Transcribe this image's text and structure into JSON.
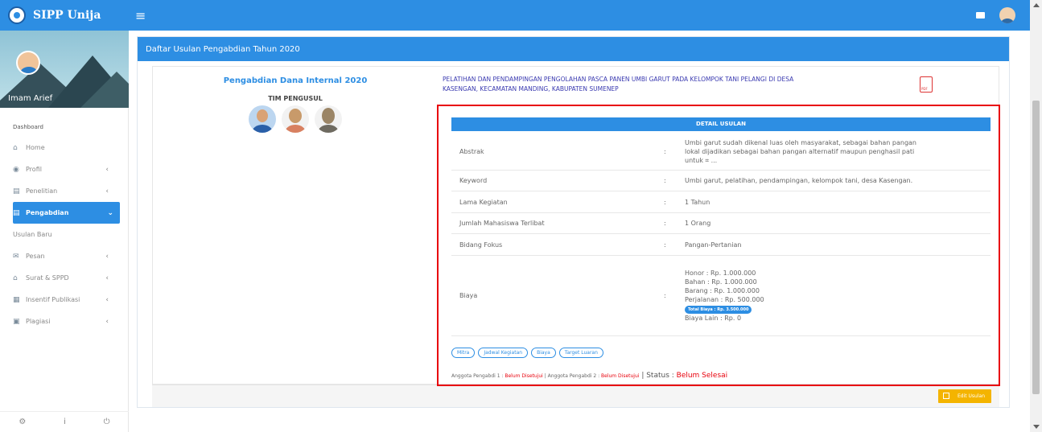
{
  "app": {
    "title": "SIPP Unija"
  },
  "user": {
    "name": "Imam Arief"
  },
  "sidebar": {
    "heading": "Dashboard",
    "items": [
      {
        "label": "Home",
        "icon": "home-icon",
        "chevron": ""
      },
      {
        "label": "Profil",
        "icon": "user-icon",
        "chevron": "‹"
      },
      {
        "label": "Penelitian",
        "icon": "book-icon",
        "chevron": "‹"
      },
      {
        "label": "Pengabdian",
        "icon": "book-icon",
        "chevron": "⌄"
      },
      {
        "label": "Usulan Baru",
        "icon": "",
        "chevron": ""
      },
      {
        "label": "Pesan",
        "icon": "mail-icon",
        "chevron": "‹"
      },
      {
        "label": "Surat & SPPD",
        "icon": "envelope-icon",
        "chevron": "‹"
      },
      {
        "label": "Insentif Publikasi",
        "icon": "calendar-icon",
        "chevron": "‹"
      },
      {
        "label": "Plagiasi",
        "icon": "monitor-icon",
        "chevron": "‹"
      }
    ],
    "footer": {
      "settings_glyph": "⚙",
      "info_glyph": "i",
      "power_glyph": "⏻"
    }
  },
  "panel": {
    "title": "Daftar Usulan Pengabdian Tahun 2020"
  },
  "usulan": {
    "scheme": "Pengabdian Dana Internal 2020",
    "tim_title": "TIM PENGUSUL",
    "judul_line1": "PELATIHAN DAN PENDAMPINGAN PENGOLAHAN PASCA PANEN UMBI GARUT PADA KELOMPOK TANI PELANGI DI DESA",
    "judul_line2": "KASENGAN, KECAMATAN MANDING, KABUPATEN SUMENEP"
  },
  "detail": {
    "title": "DETAIL USULAN",
    "abstrak_label": "Abstrak",
    "abstrak_line1": "Umbi garut sudah dikenal luas oleh masyarakat, sebagai bahan pangan",
    "abstrak_line2": "lokal dijadikan sebagai bahan pangan alternatif maupun penghasil pati",
    "abstrak_line3": "untuk ⌗ ...",
    "keyword_label": "Keyword",
    "keyword_value": "Umbi garut, pelatihan, pendampingan, kelompok tani, desa Kasengan.",
    "lama_label": "Lama Kegiatan",
    "lama_value": "1 Tahun",
    "mahasiswa_label": "Jumlah Mahasiswa Terlibat",
    "mahasiswa_value": "1 Orang",
    "bidang_label": "Bidang Fokus",
    "bidang_value": "Pangan-Pertanian",
    "biaya_label": "Biaya",
    "honor": "Honor : Rp. 1.000.000",
    "bahan": "Bahan : Rp. 1.000.000",
    "barang": "Barang : Rp. 1.000.000",
    "perjalanan": "Perjalanan : Rp. 500.000",
    "total": "Total Biaya : Rp. 3.500.000",
    "lain": "Biaya Lain : Rp. 0",
    "separator": ":"
  },
  "tabs": [
    "Mitra",
    "Jadwal Kegiatan",
    "Biaya",
    "Target Luaran"
  ],
  "status": {
    "a1_label": "Anggota Pengabdi 1 : ",
    "a1_value": "Belum Disetujui",
    "a2_label": " | Anggota Pengabdi 2 : ",
    "a2_value": "Belum Disetujui",
    "status_label": " | Status : ",
    "status_value": "Belum Selesai"
  },
  "actions": {
    "edit_label": "Edit Usulan"
  },
  "colors": {
    "primary": "#2d8ee3",
    "highlight": "#e8000b",
    "warning": "#f4b400"
  }
}
